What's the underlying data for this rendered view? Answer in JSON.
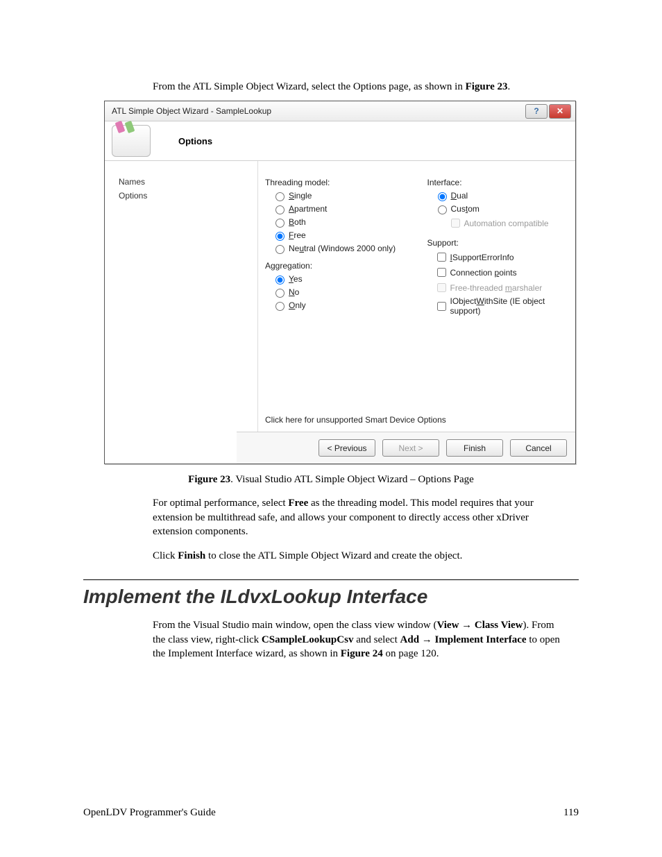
{
  "intro": {
    "line1": "From the ATL Simple Object Wizard, select the Options page, as shown in ",
    "figref": "Figure 23",
    "period": "."
  },
  "dialog": {
    "title": "ATL Simple Object Wizard - SampleLookup",
    "header": "Options",
    "nav": [
      "Names",
      "Options"
    ],
    "threading": {
      "label": "Threading model:",
      "options": [
        "Single",
        "Apartment",
        "Both",
        "Free",
        "Neutral (Windows 2000 only)"
      ],
      "selected": "Free"
    },
    "aggregation": {
      "label": "Aggregation:",
      "options": [
        "Yes",
        "No",
        "Only"
      ],
      "selected": "Yes"
    },
    "interface": {
      "label": "Interface:",
      "options": [
        "Dual",
        "Custom"
      ],
      "selected": "Dual",
      "compat": "Automation compatible"
    },
    "support": {
      "label": "Support:",
      "items": [
        {
          "label": "ISupportErrorInfo",
          "checked": false,
          "disabled": false
        },
        {
          "label": "Connection points",
          "checked": false,
          "disabled": false
        },
        {
          "label": "Free-threaded marshaler",
          "checked": false,
          "disabled": true
        },
        {
          "label": "IObjectWithSite (IE object support)",
          "checked": false,
          "disabled": false
        }
      ]
    },
    "smart_link": "Click here for unsupported Smart Device Options",
    "buttons": {
      "previous": "< Previous",
      "next": "Next >",
      "finish": "Finish",
      "cancel": "Cancel"
    }
  },
  "caption": {
    "bold": "Figure 23",
    "rest": ". Visual Studio ATL Simple Object Wizard – Options Page"
  },
  "para1_a": "For optimal performance, select ",
  "para1_b": "Free",
  "para1_c": " as the threading model.  This model requires that your extension be multithread safe, and allows your component to directly access other xDriver extension components.",
  "para2_a": "Click ",
  "para2_b": "Finish",
  "para2_c": " to close the ATL Simple Object Wizard and create the object.",
  "section": "Implement the ILdvxLookup Interface",
  "para3": {
    "a": "From the Visual Studio main window, open the class view window (",
    "b": "View → Class View",
    "c": ").  From the class view, right-click ",
    "d": "CSampleLookupCsv",
    "e": " and select ",
    "f": "Add → Implement Interface",
    "g": " to open the Implement Interface wizard, as shown in ",
    "h": "Figure 24",
    "i": " on page 120."
  },
  "footer": {
    "left": "OpenLDV Programmer's Guide",
    "right": "119"
  }
}
